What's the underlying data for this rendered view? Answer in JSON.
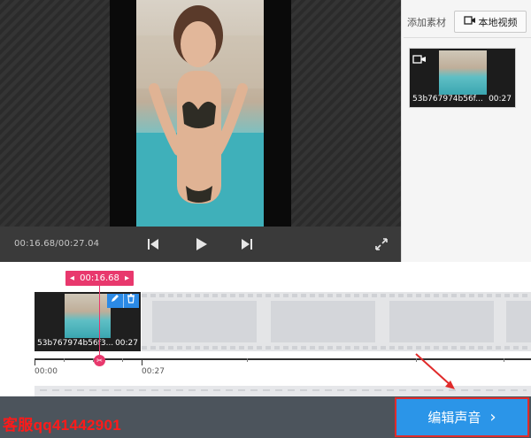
{
  "player": {
    "time_readout": "00:16.68/00:27.04",
    "icons": {
      "prev": "skip-previous-icon",
      "play": "play-icon",
      "next": "skip-next-icon",
      "fullscreen": "fullscreen-icon"
    }
  },
  "media_panel": {
    "add_material_label": "添加素材",
    "local_video_button": "本地视频",
    "clip": {
      "name": "53b767974b56f...",
      "duration": "00:27"
    }
  },
  "timeline": {
    "playhead_time": "00:16.68",
    "clip": {
      "name": "53b767974b56f3...",
      "duration": "00:27"
    },
    "ruler_labels": [
      "00:00",
      "00:27"
    ],
    "tools": [
      "edit-pencil-icon",
      "delete-trash-icon"
    ]
  },
  "bottom_bar": {
    "contact_text": "客服qq41442901",
    "edit_audio_button": "编辑声音",
    "edit_audio_arrow": "›"
  },
  "colors": {
    "accent_blue": "#2b95e8",
    "playhead_pink": "#e8386d",
    "contact_red": "#ff1a1a",
    "annotation_red": "#e02b2b"
  }
}
